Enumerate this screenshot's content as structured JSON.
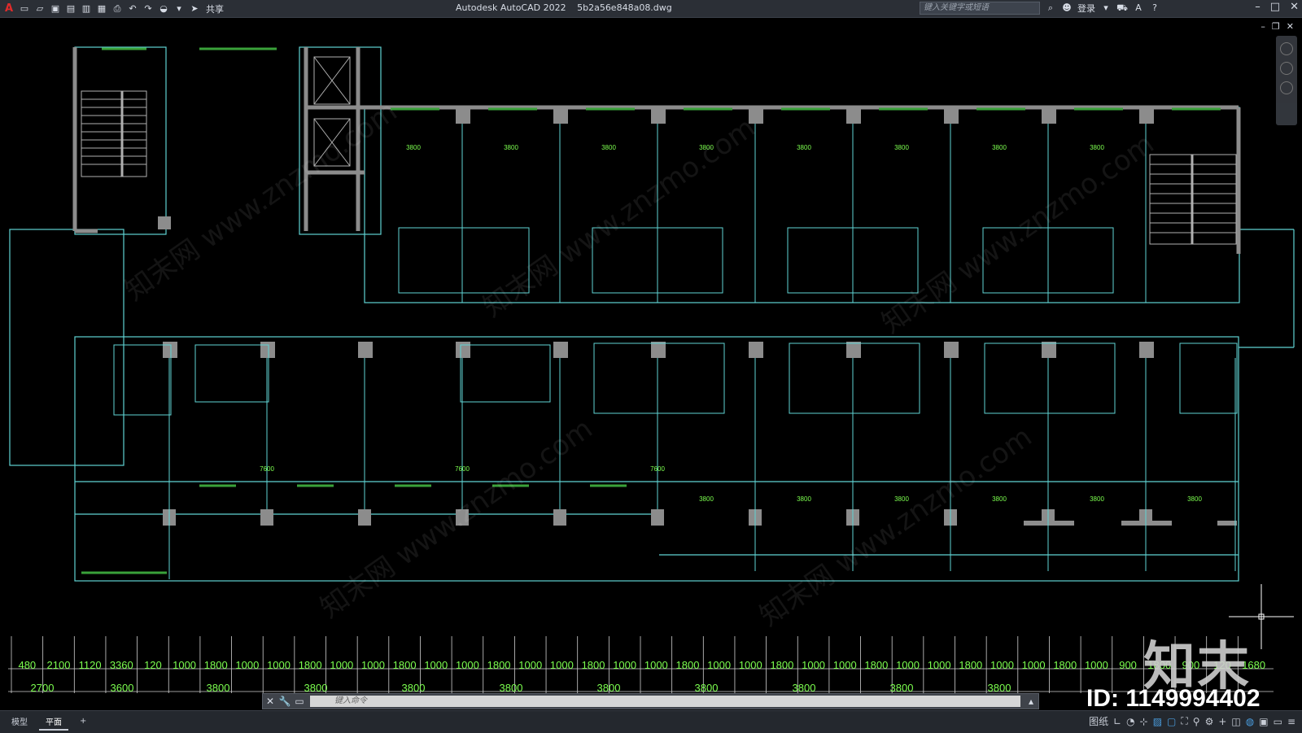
{
  "app": {
    "title": "Autodesk AutoCAD 2022",
    "filename": "5b2a56e848a08.dwg",
    "share_label": "共享",
    "search_placeholder": "键入关键字或短语",
    "login_label": "登录"
  },
  "command": {
    "placeholder": "键入命令"
  },
  "layout_tabs": [
    {
      "label": "模型",
      "active": false
    },
    {
      "label": "平面",
      "active": true
    }
  ],
  "status": {
    "paper_label": "图纸"
  },
  "watermark": {
    "logo_text": "知末",
    "id_text": "ID: 1149994402",
    "repeat_text": "知末网 www.znzmo.com"
  },
  "drawing": {
    "bay_dim": "3800",
    "top_dims": [
      "3800",
      "3800",
      "3800",
      "3800",
      "3800",
      "3800",
      "3800",
      "3800"
    ],
    "mid_dims": [
      "3800",
      "3800",
      "3800",
      "3800",
      "3800",
      "3800"
    ],
    "bottom_row_1": [
      "480",
      "2100",
      "1120",
      "3360",
      "120",
      "1000",
      "1800",
      "1000",
      "1000",
      "1800",
      "1000",
      "1000",
      "1800",
      "1000",
      "1000",
      "1800",
      "1000",
      "1000",
      "1800",
      "1000",
      "1000",
      "1800",
      "1000",
      "1000",
      "1800",
      "1000",
      "1000",
      "1800",
      "1000",
      "1000",
      "1800",
      "1000",
      "1000",
      "1800",
      "1000",
      "900",
      "1800",
      "900",
      "120",
      "1680"
    ],
    "bottom_row_2": [
      "2700",
      "3600",
      "3800",
      "3800",
      "3800",
      "3800",
      "3800",
      "3800",
      "3800",
      "3800",
      "3800"
    ],
    "corridor_dims": [
      "7600",
      "7600",
      "7600"
    ]
  }
}
